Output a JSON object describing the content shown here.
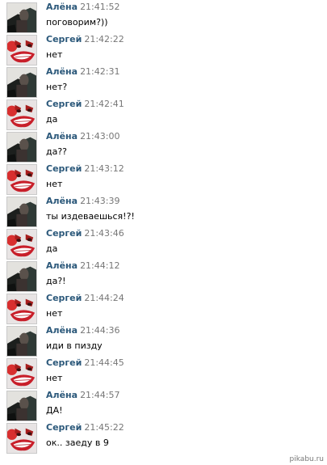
{
  "messages": [
    {
      "author": "Алёна",
      "time": "21:41:52",
      "text": "поговорим?))",
      "avatar": "alena-avatar"
    },
    {
      "author": "Сергей",
      "time": "21:42:22",
      "text": "нет",
      "avatar": "sergey-avatar"
    },
    {
      "author": "Алёна",
      "time": "21:42:31",
      "text": "нет?",
      "avatar": "alena-avatar"
    },
    {
      "author": "Сергей",
      "time": "21:42:41",
      "text": "да",
      "avatar": "sergey-avatar"
    },
    {
      "author": "Алёна",
      "time": "21:43:00",
      "text": "да??",
      "avatar": "alena-avatar"
    },
    {
      "author": "Сергей",
      "time": "21:43:12",
      "text": "нет",
      "avatar": "sergey-avatar"
    },
    {
      "author": "Алёна",
      "time": "21:43:39",
      "text": "ты издеваешься!?!",
      "avatar": "alena-avatar"
    },
    {
      "author": "Сергей",
      "time": "21:43:46",
      "text": "да",
      "avatar": "sergey-avatar"
    },
    {
      "author": "Алёна",
      "time": "21:44:12",
      "text": "да?!",
      "avatar": "alena-avatar"
    },
    {
      "author": "Сергей",
      "time": "21:44:24",
      "text": "нет",
      "avatar": "sergey-avatar"
    },
    {
      "author": "Алёна",
      "time": "21:44:36",
      "text": "иди в пизду",
      "avatar": "alena-avatar"
    },
    {
      "author": "Сергей",
      "time": "21:44:45",
      "text": "нет",
      "avatar": "sergey-avatar"
    },
    {
      "author": "Алёна",
      "time": "21:44:57",
      "text": "ДА!",
      "avatar": "alena-avatar"
    },
    {
      "author": "Сергей",
      "time": "21:45:22",
      "text": "ок.. заеду в 9",
      "avatar": "sergey-avatar"
    }
  ],
  "watermark": "pikabu.ru",
  "colors": {
    "author": "#2b587a",
    "time": "#777777",
    "text": "#000000",
    "background": "#ffffff"
  }
}
